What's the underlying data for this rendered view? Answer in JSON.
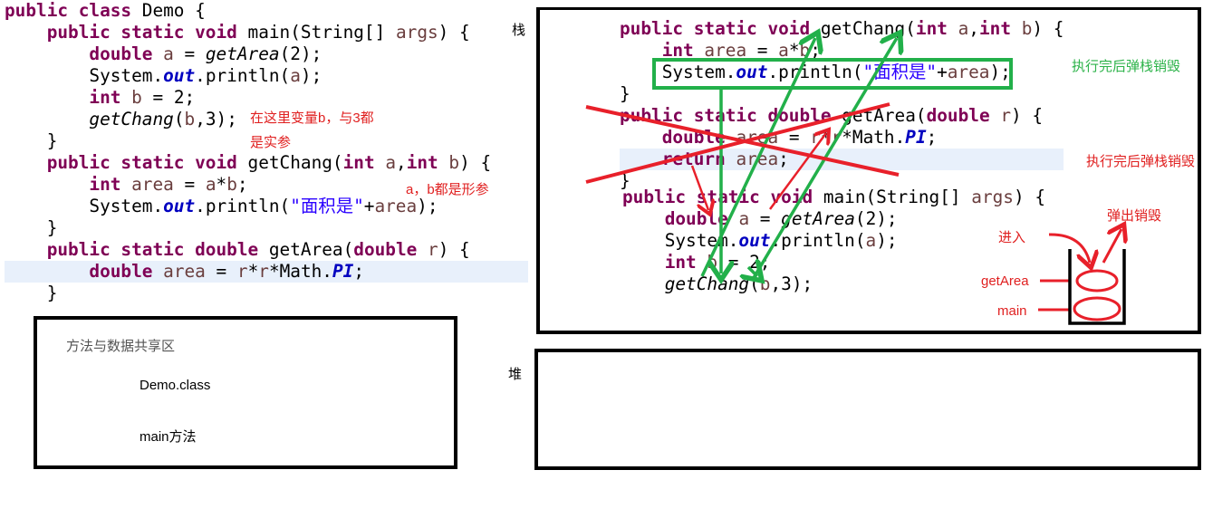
{
  "left_code": [
    [
      [
        "public class",
        "kw"
      ],
      [
        " Demo {",
        ""
      ]
    ],
    [
      [
        "    public static void",
        "kw"
      ],
      [
        " main(String[] ",
        ""
      ],
      [
        "args",
        "var"
      ],
      [
        ") {",
        ""
      ]
    ],
    [
      [
        "        double",
        "kw"
      ],
      [
        " ",
        ""
      ],
      [
        "a",
        "var"
      ],
      [
        " = ",
        ""
      ],
      [
        "getArea",
        "it"
      ],
      [
        "(2);",
        ""
      ]
    ],
    [
      [
        "        System.",
        ""
      ],
      [
        "out",
        "fld"
      ],
      [
        ".println(",
        ""
      ],
      [
        "a",
        "var"
      ],
      [
        ");",
        ""
      ]
    ],
    [
      [
        "        int",
        "kw"
      ],
      [
        " ",
        ""
      ],
      [
        "b",
        "var"
      ],
      [
        " = 2;",
        ""
      ]
    ],
    [
      [
        "        ",
        ""
      ],
      [
        "getChang",
        "it"
      ],
      [
        "(",
        ""
      ],
      [
        "b",
        "var"
      ],
      [
        ",3);",
        ""
      ]
    ],
    [
      [
        "    }",
        ""
      ]
    ],
    [
      [
        "    public static void",
        "kw"
      ],
      [
        " getChang(",
        ""
      ],
      [
        "int",
        "kw"
      ],
      [
        " ",
        ""
      ],
      [
        "a",
        "var"
      ],
      [
        ",",
        ""
      ],
      [
        "int",
        "kw"
      ],
      [
        " ",
        ""
      ],
      [
        "b",
        "var"
      ],
      [
        ") {",
        ""
      ]
    ],
    [
      [
        "        int",
        "kw"
      ],
      [
        " ",
        ""
      ],
      [
        "area",
        "var"
      ],
      [
        " = ",
        ""
      ],
      [
        "a",
        "var"
      ],
      [
        "*",
        ""
      ],
      [
        "b",
        "var"
      ],
      [
        ";",
        ""
      ]
    ],
    [
      [
        "        System.",
        ""
      ],
      [
        "out",
        "fld"
      ],
      [
        ".println(",
        ""
      ],
      [
        "\"面积是\"",
        "str"
      ],
      [
        "+",
        ""
      ],
      [
        "area",
        "var"
      ],
      [
        ");",
        ""
      ]
    ],
    [
      [
        "    }",
        ""
      ]
    ],
    [
      [
        "    public static double",
        "kw"
      ],
      [
        " getArea(",
        ""
      ],
      [
        "double",
        "kw"
      ],
      [
        " ",
        ""
      ],
      [
        "r",
        "var"
      ],
      [
        ") {",
        ""
      ]
    ],
    [
      [
        "        double",
        "kw"
      ],
      [
        " ",
        ""
      ],
      [
        "area",
        "var"
      ],
      [
        " = ",
        ""
      ],
      [
        "r",
        "var"
      ],
      [
        "*",
        ""
      ],
      [
        "r",
        "var"
      ],
      [
        "*Math.",
        ""
      ],
      [
        "PI",
        "fld"
      ],
      [
        ";",
        ""
      ]
    ],
    [
      [
        "    }",
        ""
      ]
    ]
  ],
  "right_code_top": [
    [
      [
        "public static void",
        "kw"
      ],
      [
        " getChang(",
        ""
      ],
      [
        "int",
        "kw"
      ],
      [
        " ",
        ""
      ],
      [
        "a",
        "var"
      ],
      [
        ",",
        ""
      ],
      [
        "int",
        "kw"
      ],
      [
        " ",
        ""
      ],
      [
        "b",
        "var"
      ],
      [
        ") {",
        ""
      ]
    ],
    [
      [
        "    int",
        "kw"
      ],
      [
        " ",
        ""
      ],
      [
        "area",
        "var"
      ],
      [
        " = ",
        ""
      ],
      [
        "a",
        "var"
      ],
      [
        "*",
        ""
      ],
      [
        "b",
        "var"
      ],
      [
        ";",
        ""
      ]
    ],
    [
      [
        "    System.",
        ""
      ],
      [
        "out",
        "fld"
      ],
      [
        ".println(",
        ""
      ],
      [
        "\"面积是\"",
        "str"
      ],
      [
        "+",
        ""
      ],
      [
        "area",
        "var"
      ],
      [
        ");",
        ""
      ]
    ],
    [
      [
        "}",
        ""
      ]
    ],
    [
      [
        "public static ",
        "kw"
      ],
      [
        "double",
        "kw"
      ],
      [
        " getArea(",
        ""
      ],
      [
        "double",
        "kw"
      ],
      [
        " ",
        ""
      ],
      [
        "r",
        "var"
      ],
      [
        ") {",
        ""
      ]
    ],
    [
      [
        "    double",
        "kw"
      ],
      [
        " ",
        ""
      ],
      [
        "area",
        "var"
      ],
      [
        " = ",
        ""
      ],
      [
        "r",
        "var"
      ],
      [
        "*",
        ""
      ],
      [
        "r",
        "var"
      ],
      [
        "*Math.",
        ""
      ],
      [
        "PI",
        "fld"
      ],
      [
        ";",
        ""
      ]
    ],
    [
      [
        "    return",
        "kw"
      ],
      [
        " ",
        ""
      ],
      [
        "area",
        "var"
      ],
      [
        ";",
        ""
      ]
    ],
    [
      [
        "}",
        ""
      ]
    ]
  ],
  "right_code_bottom": [
    [
      [
        "public static void",
        "kw"
      ],
      [
        " main(String[] ",
        ""
      ],
      [
        "args",
        "var"
      ],
      [
        ") {",
        ""
      ]
    ],
    [
      [
        "    double",
        "kw"
      ],
      [
        " ",
        ""
      ],
      [
        "a",
        "var"
      ],
      [
        " = ",
        ""
      ],
      [
        "getArea",
        "it"
      ],
      [
        "(2);",
        ""
      ]
    ],
    [
      [
        "    System.",
        ""
      ],
      [
        "out",
        "fld"
      ],
      [
        ".println(",
        ""
      ],
      [
        "a",
        "var"
      ],
      [
        ");",
        ""
      ]
    ],
    [
      [
        "    int",
        "kw"
      ],
      [
        " ",
        ""
      ],
      [
        "b",
        "var"
      ],
      [
        " = 2;",
        ""
      ]
    ],
    [
      [
        "    ",
        ""
      ],
      [
        "getChang",
        "it"
      ],
      [
        "(",
        ""
      ],
      [
        "b",
        "var"
      ],
      [
        ",3);",
        ""
      ]
    ]
  ],
  "annotations": {
    "actual_params_1": "在这里变量b，与3都",
    "actual_params_2": "是实参",
    "formal_params": "a，b都是形参",
    "stack_label": "栈",
    "heap_label": "堆",
    "pop_green": "执行完后弹栈销毁",
    "pop_red": "执行完后弹栈销毁",
    "enter": "进入",
    "pop_destroy": "弹出销毁",
    "frame_getarea": "getArea",
    "frame_main": "main"
  },
  "method_area": {
    "title": "方法与数据共享区",
    "class_item": "Demo.class",
    "method_item": "main方法"
  },
  "colors": {
    "red": "#e8202a",
    "green": "#22b04a",
    "keyword": "#7f0055",
    "field": "#0000c0",
    "string": "#2a00ff"
  }
}
